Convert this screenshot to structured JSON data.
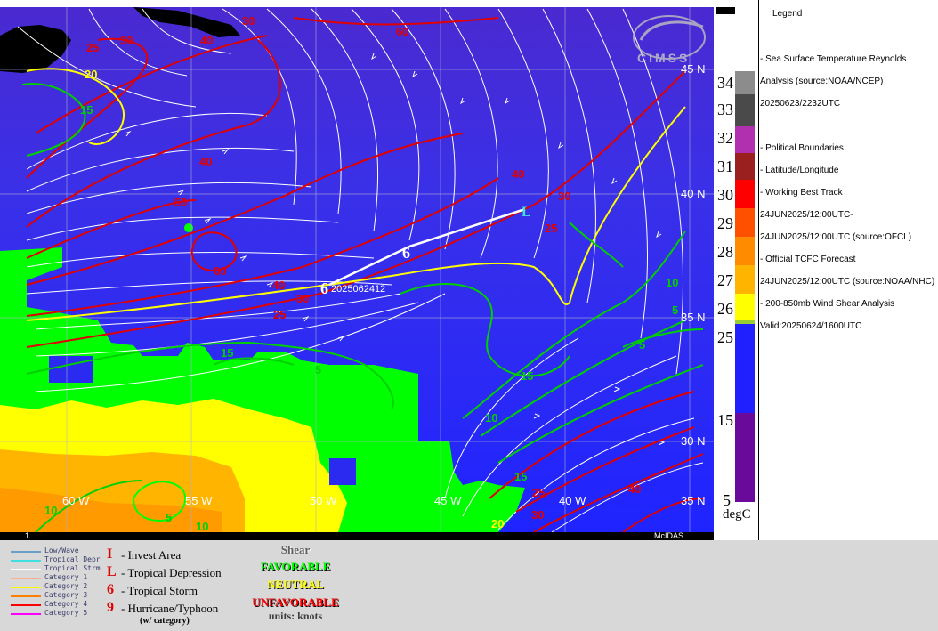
{
  "map": {
    "lat_labels": [
      "45 N",
      "40 N",
      "35 N",
      "30 N",
      "35 N"
    ],
    "lon_labels": [
      "60 W",
      "55 W",
      "50 W",
      "45 W",
      "40 W"
    ],
    "sst_contours": [
      "25",
      "30",
      "40",
      "50",
      "60",
      "80",
      "30",
      "40",
      "30",
      "25",
      "25",
      "40",
      "30",
      "25",
      "40",
      "30",
      "25",
      "20",
      "15",
      "10",
      "5",
      "15",
      "5",
      "15",
      "10",
      "10",
      "15",
      "5",
      "10",
      "15",
      "20",
      "25",
      "30",
      "40",
      "10",
      "5"
    ],
    "track_label": "2025062412",
    "storm_current_symbol": "L",
    "footer_left": "1",
    "footer_right": "McIDAS",
    "logo_text": "CIMSS"
  },
  "colorbar": {
    "labels": [
      "34",
      "33",
      "32",
      "31",
      "30",
      "29",
      "28",
      "27",
      "26",
      "25",
      "15",
      "5"
    ],
    "unit": "degC",
    "colors": [
      "#8c8c8c",
      "#5a5a5a",
      "#b030b0",
      "#9a2020",
      "#ff0000",
      "#ff5000",
      "#ff8c00",
      "#ffb400",
      "#ffff00",
      "#9acd32",
      "#2a2aff",
      "#6a0a9a"
    ]
  },
  "legend": {
    "title": "Legend",
    "lines": [
      "-  Sea Surface Temperature  Reynolds",
      "Analysis  (source:NOAA/NCEP)",
      "20250623/2232UTC",
      "-  Political Boundaries",
      "-  Latitude/Longitude",
      "-  Working Best Track",
      "24JUN2025/12:00UTC-",
      "24JUN2025/12:00UTC   (source:OFCL)",
      "-  Official TCFC Forecast",
      "24JUN2025/12:00UTC  (source:NOAA/NHC)",
      "-  200-850mb Wind Shear Analysis",
      "Valid:20250624/1600UTC"
    ]
  },
  "bottom": {
    "track_key": [
      {
        "label": "Low/Wave",
        "color": "#6aa0c8"
      },
      {
        "label": "Tropical Depr",
        "color": "#40e0e0"
      },
      {
        "label": "Tropical Strm",
        "color": "#ffffff"
      },
      {
        "label": "Category 1",
        "color": "#ffb090"
      },
      {
        "label": "Category 2",
        "color": "#ffff00"
      },
      {
        "label": "Category 3",
        "color": "#ff8000"
      },
      {
        "label": "Category 4",
        "color": "#ff0000"
      },
      {
        "label": "Category 5",
        "color": "#ff00ff"
      }
    ],
    "symbols": [
      {
        "glyph": "I",
        "label": "- Invest Area"
      },
      {
        "glyph": "L",
        "label": "- Tropical Depression"
      },
      {
        "glyph": "6",
        "label": "- Tropical Storm"
      },
      {
        "glyph": "9",
        "label": "- Hurricane/Typhoon"
      }
    ],
    "symbols_note": "(w/ category)",
    "shear": {
      "title": "Shear",
      "favorable": "FAVORABLE",
      "neutral": "NEUTRAL",
      "unfavorable": "UNFAVORABLE",
      "units": "units: knots"
    }
  }
}
